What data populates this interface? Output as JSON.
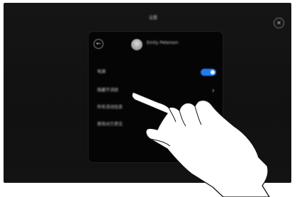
{
  "screen": {
    "title": "设置",
    "close_icon": "close-icon",
    "close_glyph": "✕"
  },
  "panel": {
    "back_icon": "back-arrow-icon",
    "back_glyph": "←",
    "user_name": "Emily Peterson",
    "rows": [
      {
        "label": "电源",
        "control": "toggle",
        "toggle_on": true,
        "accent": "#1f7cf2"
      },
      {
        "label": "隐藏不活跃",
        "control": "chevron"
      },
      {
        "label": "所有活动信息",
        "control": "chevron"
      },
      {
        "label": "更改对方意见",
        "control": "none"
      }
    ],
    "chevron_glyph": "›"
  },
  "overlay": {
    "icon": "pointing-hand-icon"
  }
}
